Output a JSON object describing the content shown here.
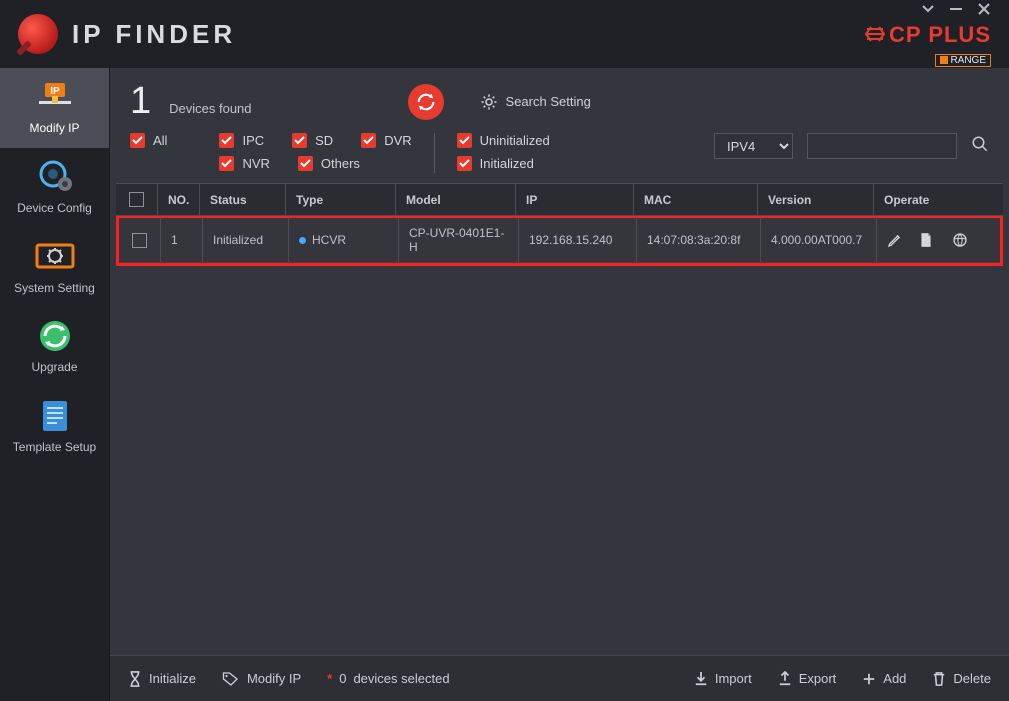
{
  "title": "IP FINDER",
  "brand": {
    "cp": "CP PLUS",
    "orange": "RANGE"
  },
  "sidebar": {
    "items": [
      {
        "label": "Modify IP"
      },
      {
        "label": "Device Config"
      },
      {
        "label": "System Setting"
      },
      {
        "label": "Upgrade"
      },
      {
        "label": "Template Setup"
      }
    ]
  },
  "toolbar": {
    "devices_count": "1",
    "devices_label": "Devices found",
    "search_setting": "Search Setting"
  },
  "filters": {
    "all": "All",
    "ipc": "IPC",
    "sd": "SD",
    "dvr": "DVR",
    "nvr": "NVR",
    "others": "Others",
    "uninitialized": "Uninitialized",
    "initialized": "Initialized",
    "ip_version": "IPV4"
  },
  "table": {
    "headers": {
      "no": "NO.",
      "status": "Status",
      "type": "Type",
      "model": "Model",
      "ip": "IP",
      "mac": "MAC",
      "version": "Version",
      "operate": "Operate"
    },
    "rows": [
      {
        "no": "1",
        "status": "Initialized",
        "type": "HCVR",
        "model": "CP-UVR-0401E1-H",
        "ip": "192.168.15.240",
        "mac": "14:07:08:3a:20:8f",
        "version": "4.000.00AT000.7"
      }
    ]
  },
  "footer": {
    "initialize": "Initialize",
    "modify_ip": "Modify IP",
    "selected_count": "0",
    "selected_label": "devices selected",
    "import": "Import",
    "export": "Export",
    "add": "Add",
    "delete": "Delete"
  }
}
